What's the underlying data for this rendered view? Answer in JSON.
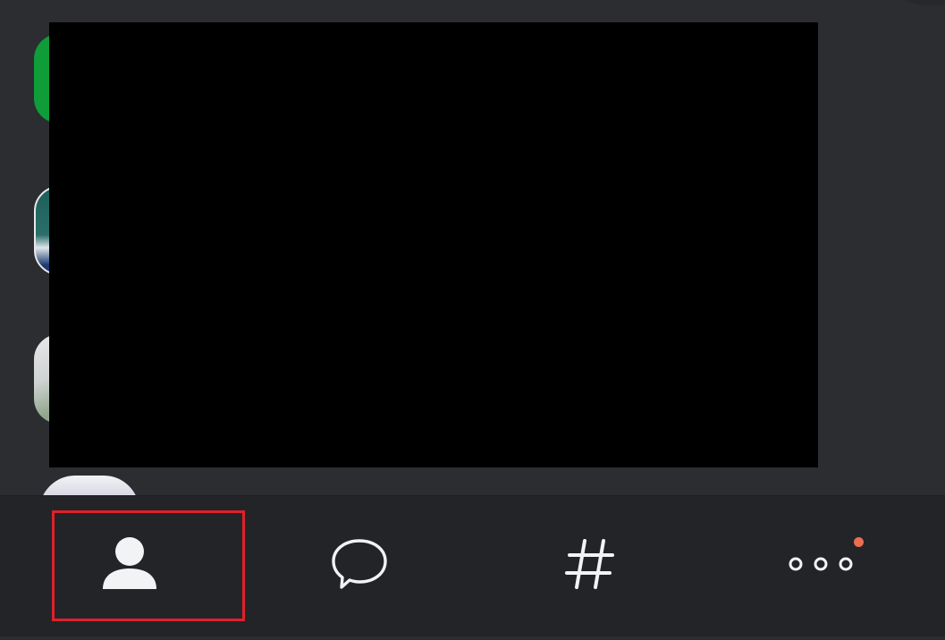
{
  "colors": {
    "background": "#2b2d31",
    "nav_background": "#232428",
    "icon": "#f2f3f5",
    "highlight": "#e0202a",
    "notification_dot": "#ed6d52"
  },
  "server_rail": {
    "items": [
      {
        "name": "server-green",
        "color": "#0f9d3a"
      },
      {
        "name": "server-landscape"
      },
      {
        "name": "server-light"
      },
      {
        "name": "server-partial"
      }
    ]
  },
  "bottom_nav": {
    "items": [
      {
        "id": "profile",
        "icon": "person-icon",
        "selected": true
      },
      {
        "id": "messages",
        "icon": "chat-bubble-icon"
      },
      {
        "id": "channels",
        "icon": "hash-icon"
      },
      {
        "id": "more",
        "icon": "more-dots-icon",
        "has_notification": true
      }
    ]
  }
}
